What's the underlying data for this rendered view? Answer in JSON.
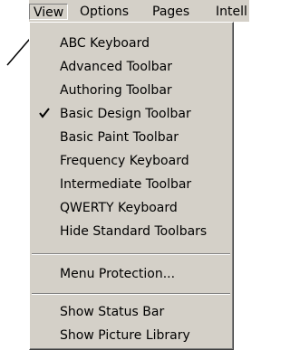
{
  "menubar": {
    "items": [
      {
        "label": "View"
      },
      {
        "label": "Options"
      },
      {
        "label": "Pages"
      },
      {
        "label": "Intell"
      }
    ]
  },
  "view_menu": {
    "items": [
      {
        "label": "ABC Keyboard",
        "checked": false
      },
      {
        "label": "Advanced Toolbar",
        "checked": false
      },
      {
        "label": "Authoring Toolbar",
        "checked": true
      },
      {
        "label": "Basic Design Toolbar",
        "checked": false
      },
      {
        "label": "Basic Paint Toolbar",
        "checked": false
      },
      {
        "label": "Frequency Keyboard",
        "checked": false
      },
      {
        "label": "Intermediate Toolbar",
        "checked": false
      },
      {
        "label": "QWERTY Keyboard",
        "checked": false
      },
      {
        "label": "Hide Standard Toolbars",
        "checked": false
      },
      {
        "label": "Menu Protection...",
        "checked": false
      },
      {
        "label": "Show Status Bar",
        "checked": false
      },
      {
        "label": "Show Picture Library",
        "checked": false
      }
    ]
  },
  "icons": {
    "check": "checkmark-icon",
    "pointer": "pointer-arrow-icon"
  },
  "colors": {
    "menu_background": "#d4d0c8",
    "text": "#000000",
    "separator_dark": "#808080",
    "separator_light": "#ffffff"
  }
}
